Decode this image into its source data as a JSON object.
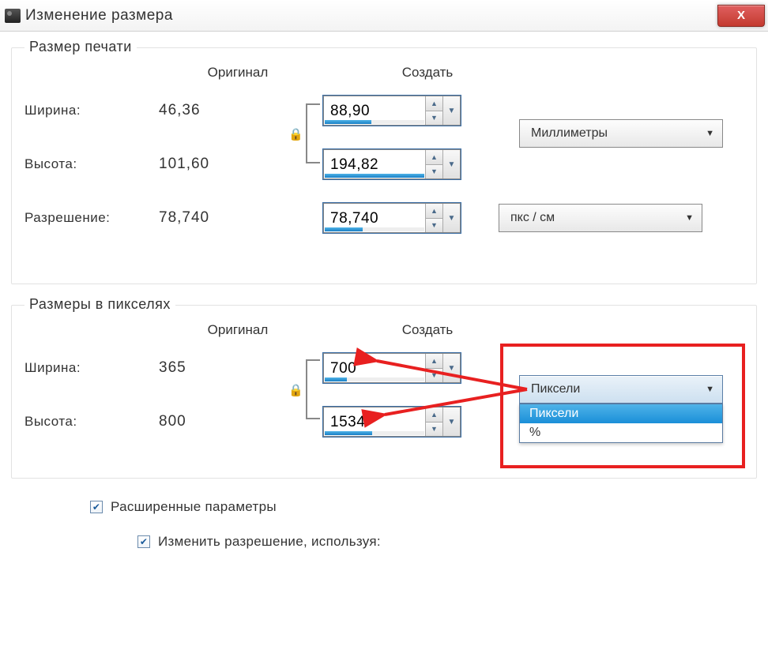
{
  "window": {
    "title": "Изменение размера",
    "close_symbol": "X"
  },
  "print_size": {
    "group_title": "Размер печати",
    "col_original": "Оригинал",
    "col_create": "Создать",
    "width_label": "Ширина:",
    "width_orig": "46,36",
    "width_new": "88,90",
    "width_progress": 47,
    "height_label": "Высота:",
    "height_orig": "101,60",
    "height_new": "194,82",
    "height_progress": 100,
    "res_label": "Разрешение:",
    "res_orig": "78,740",
    "res_new": "78,740",
    "res_progress": 38,
    "unit_size": "Миллиметры",
    "unit_res": "пкс / см"
  },
  "pixel_size": {
    "group_title": "Размеры в пикселях",
    "col_original": "Оригинал",
    "col_create": "Создать",
    "width_label": "Ширина:",
    "width_orig": "365",
    "width_new": "700",
    "width_progress": 22,
    "height_label": "Высота:",
    "height_orig": "800",
    "height_new": "1534",
    "height_progress": 48,
    "unit_selected": "Пиксели",
    "unit_options": {
      "opt1": "Пиксели",
      "opt2": "%"
    }
  },
  "advanced": {
    "advanced_label": "Расширенные параметры",
    "change_res_label": "Изменить разрешение, используя:"
  }
}
